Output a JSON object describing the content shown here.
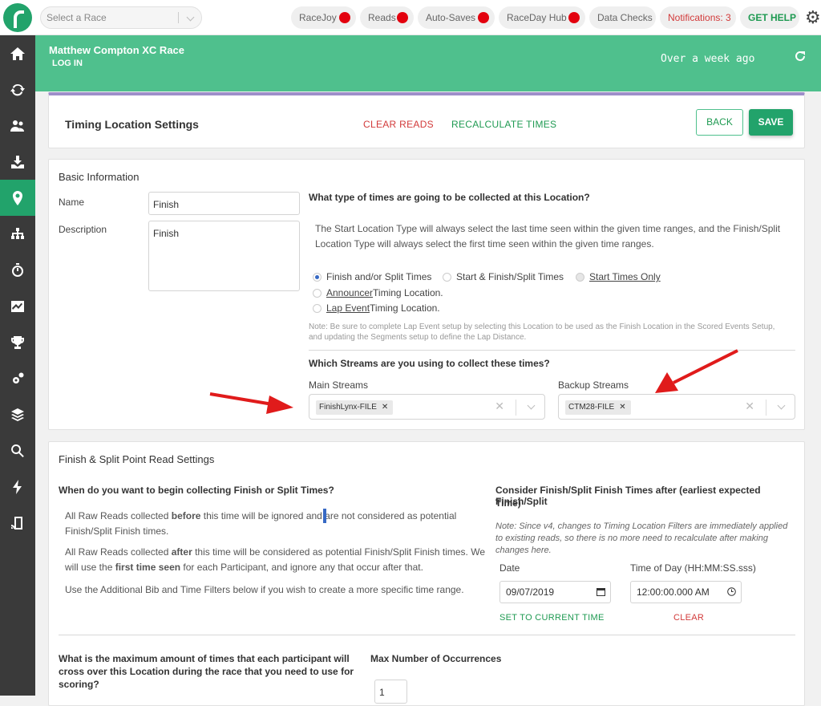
{
  "topbar": {
    "race_select_placeholder": "Select a Race",
    "status_pills": [
      {
        "label": "RaceJoy",
        "status_color": "#e3000e"
      },
      {
        "label": "Reads",
        "status_color": "#e3000e"
      },
      {
        "label": "Auto-Saves",
        "status_color": "#e3000e"
      },
      {
        "label": "RaceDay Hub",
        "status_color": "#e3000e"
      }
    ],
    "data_checks": "Data Checks",
    "notifications": "Notifications: 3",
    "get_help": "GET HELP"
  },
  "sidebar": {
    "items": [
      "home-icon",
      "sync-icon",
      "participants-icon",
      "download-icon",
      "location-icon",
      "hierarchy-icon",
      "stopwatch-icon",
      "chart-icon",
      "trophy-icon",
      "gears-icon",
      "layers-icon",
      "search-icon",
      "bolt-icon",
      "device-icon"
    ],
    "active_item": "location-icon"
  },
  "header": {
    "race_name": "Matthew Compton XC Race",
    "login": "LOG IN",
    "last_update": "Over a week ago",
    "accent": "#4fc08d"
  },
  "title_card": {
    "title": "Timing Location Settings",
    "clear_reads": "CLEAR READS",
    "recalculate": "RECALCULATE TIMES",
    "back": "BACK",
    "save": "SAVE"
  },
  "basic": {
    "heading": "Basic Information",
    "name_label": "Name",
    "name_value": "Finish",
    "description_label": "Description",
    "description_value": "Finish",
    "times_question": "What type of times are going to be collected at this Location?",
    "times_desc_1": "The Start Location Type will always select the last time seen within the given time ranges, and the Finish/Split",
    "times_desc_2": "Location Type will always select the first time seen within the given time ranges.",
    "options": {
      "finish_split": "Finish and/or Split Times",
      "start_finish": "Start & Finish/Split Times",
      "start_only": "Start Times Only",
      "announcer_a": "Announcer",
      "announcer_b": " Timing Location.",
      "lap_a": "Lap Event",
      "lap_b": " Timing Location."
    },
    "selected_option": "finish_split",
    "lap_note_1": "Note: Be sure to complete Lap Event setup by selecting this Location to be used as the Finish Location in the Scored Events Setup,",
    "lap_note_2": "and updating the Segments setup to define the Lap Distance.",
    "streams_question": "Which Streams are you using to collect these times?",
    "main_streams_label": "Main Streams",
    "main_streams": [
      "FinishLynx-FILE"
    ],
    "backup_streams_label": "Backup Streams",
    "backup_streams": [
      "CTM28-FILE"
    ]
  },
  "finish_card": {
    "heading": "Finish & Split Point Read Settings",
    "begin_question": "When do you want to begin collecting Finish or Split Times?",
    "p1_a": "All Raw Reads collected ",
    "p1_b": "before",
    "p1_c": " this time will be ignored and are not considered as potential",
    "p1_d": "Finish/Split Finish times.",
    "p2_a": "All Raw Reads collected ",
    "p2_b": "after",
    "p2_c": " this time will be considered as potential Finish/Split Finish times. We",
    "p2_d": "will use the ",
    "p2_e": "first time seen",
    "p2_f": " for each Participant, and ignore any that occur after that.",
    "p3": "Use the Additional Bib and Time Filters below if you wish to create a more specific time range.",
    "consider_q_1": "Consider Finish/Split Finish Times after (earliest expected Finish/Split",
    "consider_q_2": "Time)",
    "v4_note_1": "Note: Since v4, changes to Timing Location Filters are immediately applied",
    "v4_note_2": "to existing reads, so there is no more need to recalculate after making",
    "v4_note_3": "changes here.",
    "date_label": "Date",
    "date_value": "09/07/2019",
    "time_label": "Time of Day (HH:MM:SS.sss)",
    "time_value": "12:00:00.000  AM",
    "set_current": "SET TO CURRENT TIME",
    "clear": "CLEAR",
    "max_q_1": "What is the maximum amount of times that each participant will",
    "max_q_2": "cross over this Location during the race that you need to use for",
    "max_q_3": "scoring?",
    "max_label": "Max Number of Occurrences",
    "max_value": "1"
  }
}
